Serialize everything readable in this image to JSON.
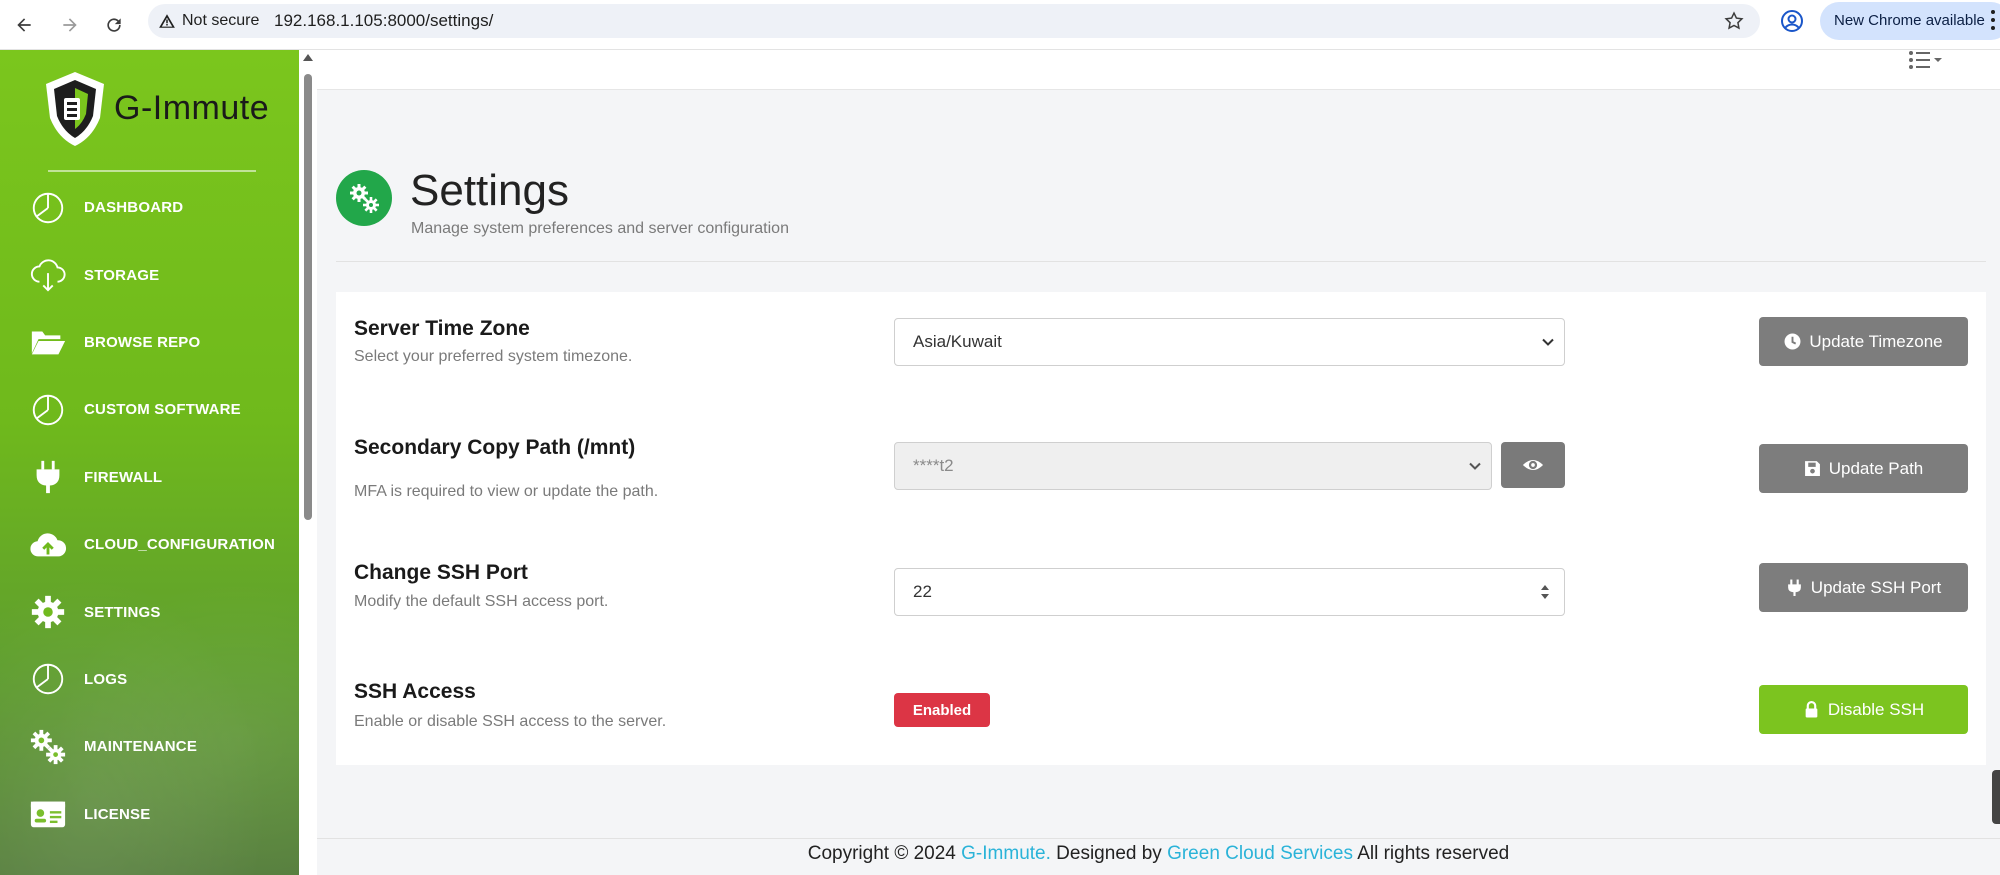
{
  "browser": {
    "security_label": "Not secure",
    "url": "192.168.1.105:8000/settings/",
    "update_pill": "New Chrome available"
  },
  "brand": {
    "name": "G-Immute"
  },
  "sidebar": {
    "items": [
      {
        "label": "DASHBOARD",
        "icon": "pie-chart-icon"
      },
      {
        "label": "STORAGE",
        "icon": "cloud-download-icon"
      },
      {
        "label": "BROWSE REPO",
        "icon": "folder-open-icon"
      },
      {
        "label": "CUSTOM SOFTWARE",
        "icon": "pie-chart-icon"
      },
      {
        "label": "FIREWALL",
        "icon": "plug-icon"
      },
      {
        "label": "CLOUD_CONFIGURATION",
        "icon": "cloud-upload-icon"
      },
      {
        "label": "SETTINGS",
        "icon": "gear-icon"
      },
      {
        "label": "LOGS",
        "icon": "pie-chart-icon"
      },
      {
        "label": "MAINTENANCE",
        "icon": "gears-icon"
      },
      {
        "label": "LICENSE",
        "icon": "id-card-icon"
      }
    ]
  },
  "header": {
    "title": "Settings",
    "subtitle": "Manage system preferences and server configuration"
  },
  "settings": {
    "timezone": {
      "title": "Server Time Zone",
      "description": "Select your preferred system timezone.",
      "value": "Asia/Kuwait",
      "button": "Update Timezone"
    },
    "secondary_path": {
      "title": "Secondary Copy Path (/mnt)",
      "description": "MFA is required to view or update the path.",
      "value": "****t2",
      "button": "Update Path"
    },
    "ssh_port": {
      "title": "Change SSH Port",
      "description": "Modify the default SSH access port.",
      "value": "22",
      "button": "Update SSH Port"
    },
    "ssh_access": {
      "title": "SSH Access",
      "description": "Enable or disable SSH access to the server.",
      "status": "Enabled",
      "button": "Disable SSH"
    }
  },
  "footer": {
    "prefix": "Copyright © 2024",
    "brand_link": "G-Immute.",
    "middle": "Designed by",
    "designer_link": "Green Cloud Services",
    "suffix": "All rights reserved"
  },
  "colors": {
    "sidebar_green": "#7bc61d",
    "header_icon_green": "#22a74a",
    "button_gray": "#7d7d7d",
    "button_green": "#7cc41f",
    "badge_red": "#dc3545",
    "link": "#2ab3d8"
  }
}
